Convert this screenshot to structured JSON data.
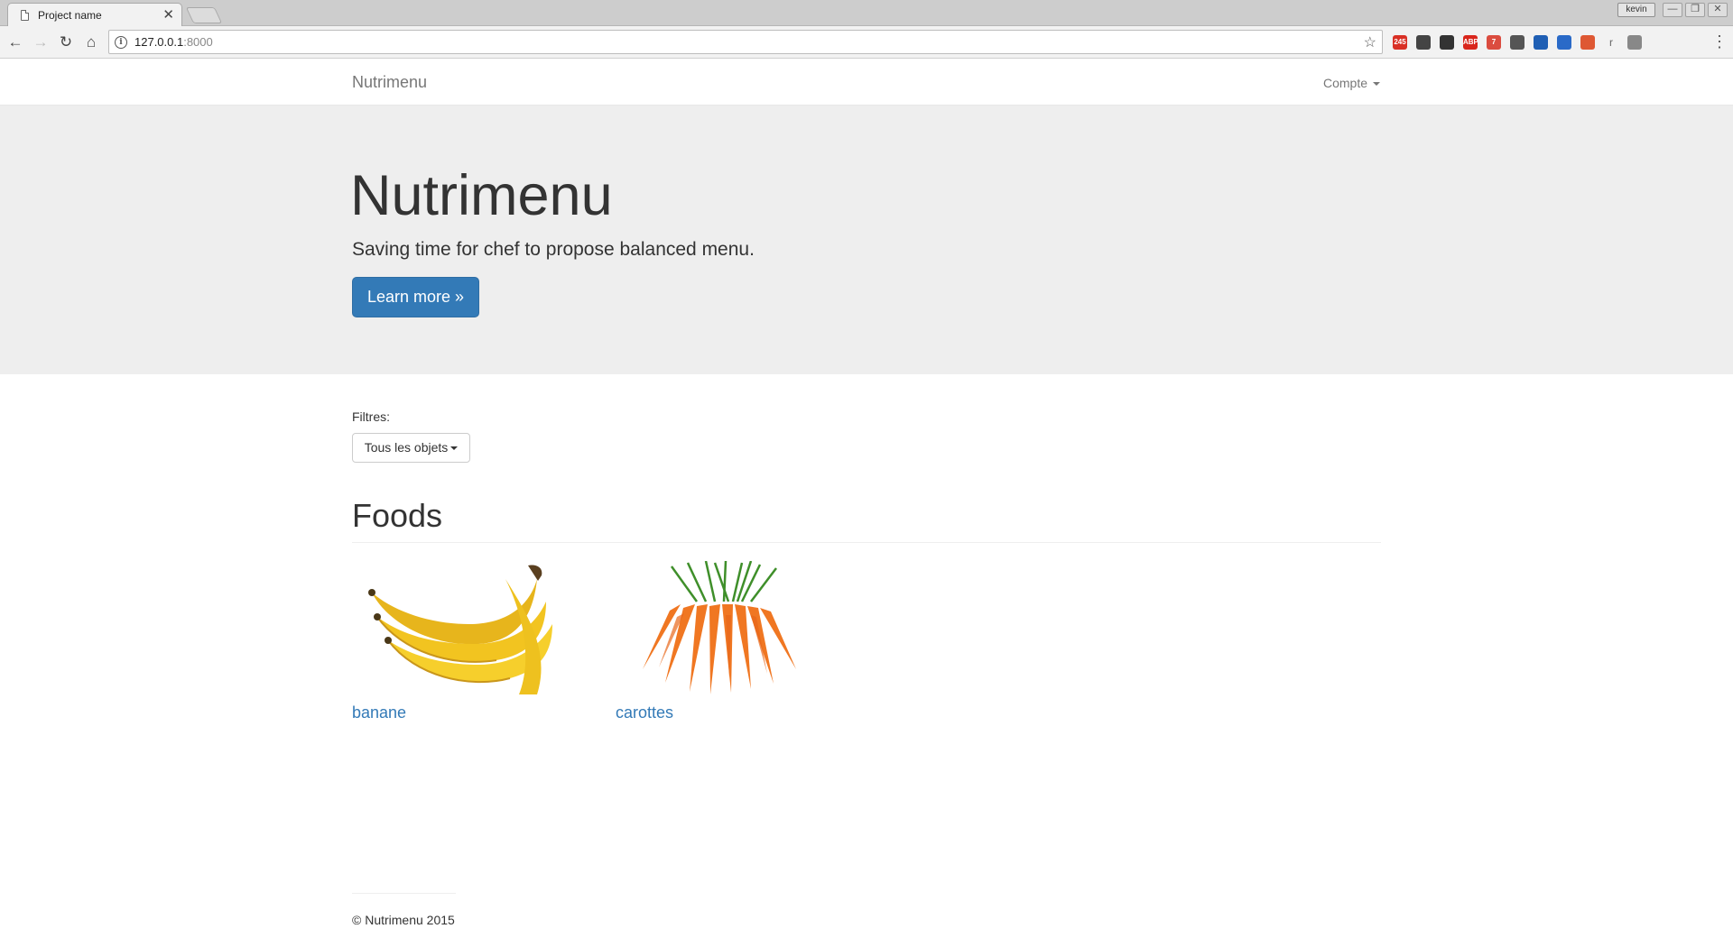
{
  "browser": {
    "tab_title": "Project name",
    "tab_close": "✕",
    "user_badge": "kevin",
    "window_controls": [
      "—",
      "❐",
      "✕"
    ],
    "url_host": "127.0.0.1",
    "url_port": ":8000",
    "nav": {
      "back": "←",
      "forward": "→",
      "reload": "↻",
      "home": "⌂"
    },
    "star": "☆",
    "extensions": [
      {
        "name": "gmail-icon",
        "label": "245",
        "color": "#d93025"
      },
      {
        "name": "pocket-icon",
        "label": "",
        "color": "#444444"
      },
      {
        "name": "evernote-icon",
        "label": "",
        "color": "#333333"
      },
      {
        "name": "adblock-plus-icon",
        "label": "ABP",
        "color": "#d9261c"
      },
      {
        "name": "todoist-icon",
        "label": "7",
        "color": "#db4c3f"
      },
      {
        "name": "upload-icon",
        "label": "",
        "color": "#555555"
      },
      {
        "name": "flag-icon",
        "label": "",
        "color": "#1f5fb4"
      },
      {
        "name": "clock-icon",
        "label": "",
        "color": "#2a6ac8"
      },
      {
        "name": "duckduckgo-icon",
        "label": "",
        "color": "#de5833"
      },
      {
        "name": "r-icon",
        "label": "r",
        "color": "#666666"
      },
      {
        "name": "settings-extension-icon",
        "label": "",
        "color": "#888888"
      }
    ],
    "menu": "⋮"
  },
  "navbar": {
    "brand": "Nutrimenu",
    "account": "Compte"
  },
  "hero": {
    "title": "Nutrimenu",
    "lead": "Saving time for chef to propose balanced menu.",
    "button": "Learn more »"
  },
  "filters": {
    "label": "Filtres:",
    "selected": "Tous les objets"
  },
  "foods": {
    "heading": "Foods",
    "items": [
      {
        "name": "banane"
      },
      {
        "name": "carottes"
      }
    ]
  },
  "footer": {
    "copyright": "© Nutrimenu 2015"
  }
}
